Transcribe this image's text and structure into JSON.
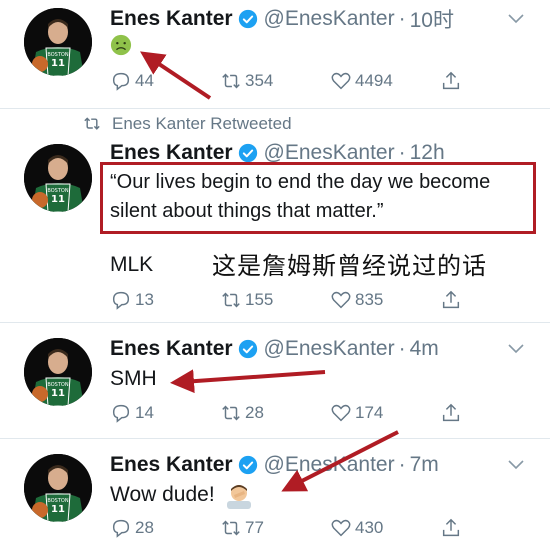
{
  "tweets": [
    {
      "name": "Enes Kanter",
      "handle": "@EnesKanter",
      "time": "10时",
      "text": "",
      "emoji": "nauseated-face",
      "replies": "44",
      "retweets": "354",
      "likes": "4494"
    },
    {
      "retweet_label": "Enes Kanter Retweeted",
      "name": "Enes Kanter",
      "handle": "@EnesKanter",
      "time": "12h",
      "quote": "“Our lives begin to end the day we become silent about things that matter.”",
      "text": "MLK",
      "replies": "13",
      "retweets": "155",
      "likes": "835"
    },
    {
      "name": "Enes Kanter",
      "handle": "@EnesKanter",
      "time": "4m",
      "text": "SMH",
      "replies": "14",
      "retweets": "28",
      "likes": "174"
    },
    {
      "name": "Enes Kanter",
      "handle": "@EnesKanter",
      "time": "7m",
      "text": "Wow dude!",
      "emoji": "facepalm",
      "replies": "28",
      "retweets": "77",
      "likes": "430"
    }
  ],
  "annotation": {
    "text": "这是詹姆斯曾经说过的话"
  },
  "jersey": {
    "team": "BOSTON",
    "number": "11"
  },
  "colors": {
    "verified": "#1da1f2",
    "secondary_text": "#657786",
    "annotation_red": "#b01c24",
    "jersey_green": "#1e6b3a"
  }
}
